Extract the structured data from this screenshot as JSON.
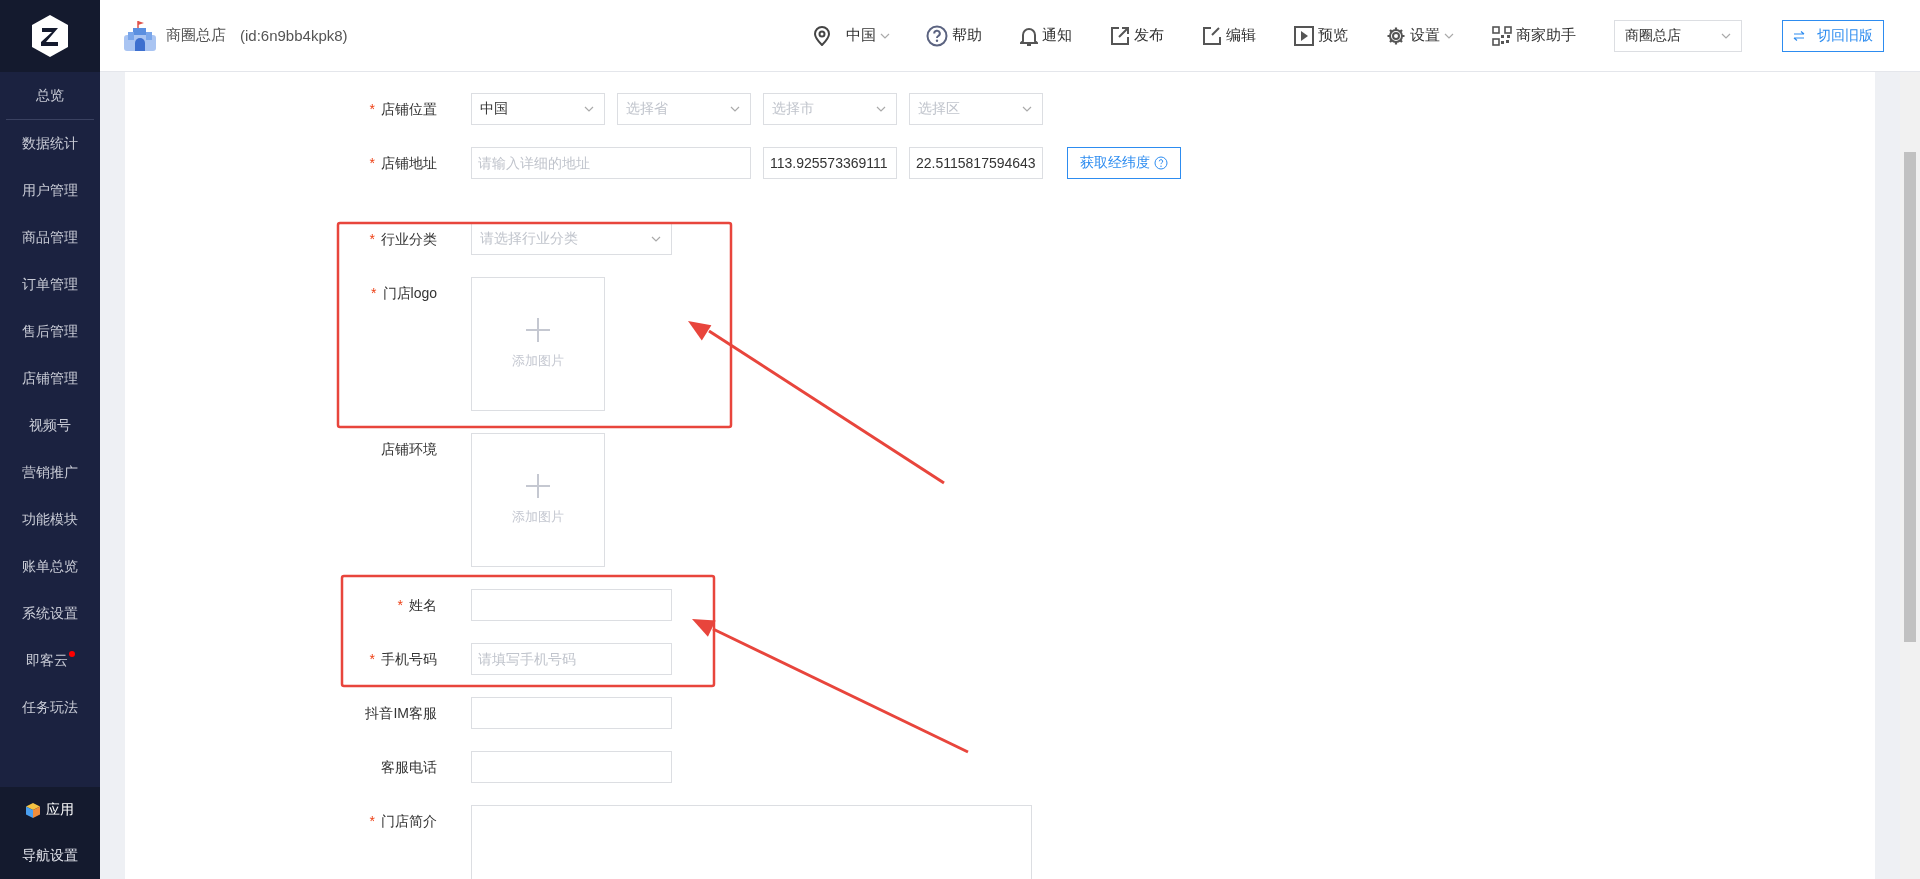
{
  "header": {
    "shop_name": "商圈总店",
    "shop_id": "(id:6n9bb4kpk8)",
    "region": "中国",
    "actions": [
      {
        "kind": "help",
        "label": "帮助"
      },
      {
        "kind": "bell",
        "label": "通知"
      },
      {
        "kind": "publish",
        "label": "发布"
      },
      {
        "kind": "edit",
        "label": "编辑"
      },
      {
        "kind": "preview",
        "label": "预览"
      },
      {
        "kind": "settings",
        "label": "设置"
      },
      {
        "kind": "qr",
        "label": "商家助手"
      }
    ],
    "store_select": "商圈总店",
    "switch_button": "切回旧版"
  },
  "sidebar": {
    "items": [
      {
        "label": "总览",
        "notify": false
      },
      {
        "label": "数据统计",
        "notify": false
      },
      {
        "label": "用户管理",
        "notify": false
      },
      {
        "label": "商品管理",
        "notify": false
      },
      {
        "label": "订单管理",
        "notify": false
      },
      {
        "label": "售后管理",
        "notify": false
      },
      {
        "label": "店铺管理",
        "notify": false
      },
      {
        "label": "视频号",
        "notify": false
      },
      {
        "label": "营销推广",
        "notify": false
      },
      {
        "label": "功能模块",
        "notify": false
      },
      {
        "label": "账单总览",
        "notify": false
      },
      {
        "label": "系统设置",
        "notify": false
      },
      {
        "label": "即客云",
        "notify": true
      },
      {
        "label": "任务玩法",
        "notify": false
      }
    ],
    "bottom": [
      {
        "kind": "apps",
        "label": "应用"
      },
      {
        "kind": "nav",
        "label": "导航设置"
      }
    ]
  },
  "form": {
    "required_mark": "*",
    "rows": [
      {
        "kind": "selects",
        "label": "店铺位置",
        "required": true,
        "fields": [
          {
            "value": "中国"
          },
          {
            "placeholder": "选择省"
          },
          {
            "placeholder": "选择市"
          },
          {
            "placeholder": "选择区"
          }
        ]
      },
      {
        "kind": "address",
        "label": "店铺地址",
        "required": true,
        "fields": [
          {
            "placeholder": "请输入详细的地址"
          },
          {
            "value": "113.925573369111"
          },
          {
            "value": "22.5115817594643"
          }
        ],
        "button": "获取经纬度"
      },
      {
        "kind": "select",
        "label": "行业分类",
        "required": true,
        "placeholder": "请选择行业分类"
      },
      {
        "kind": "upload",
        "label": "门店logo",
        "required": true,
        "text": "添加图片"
      },
      {
        "kind": "upload",
        "label": "店铺环境",
        "required": false,
        "text": "添加图片"
      },
      {
        "kind": "input",
        "label": "姓名",
        "required": true,
        "placeholder": ""
      },
      {
        "kind": "input",
        "label": "手机号码",
        "required": true,
        "placeholder": "请填写手机号码"
      },
      {
        "kind": "input",
        "label": "抖音IM客服",
        "required": false,
        "placeholder": ""
      },
      {
        "kind": "input",
        "label": "客服电话",
        "required": false,
        "placeholder": ""
      },
      {
        "kind": "textarea",
        "label": "门店简介",
        "required": true
      }
    ]
  }
}
